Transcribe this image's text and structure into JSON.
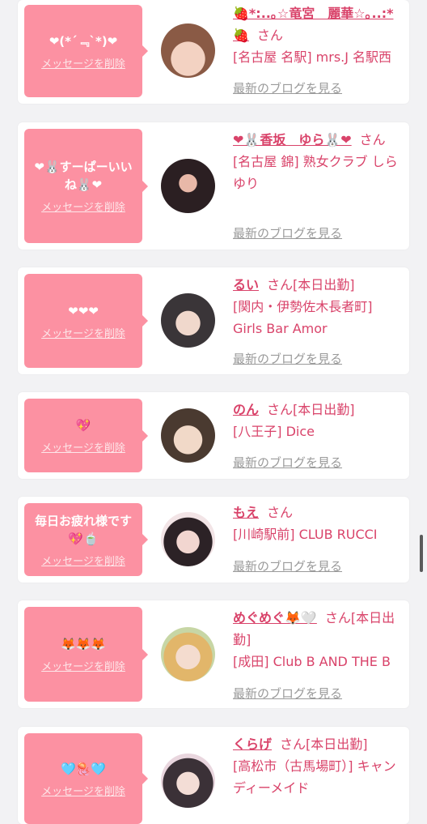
{
  "cards": [
    {
      "message": "❤(*´﹃`*)❤",
      "delete_label": "メッセージを削除",
      "name": "🍓*:..｡☆竜宮　麗華☆｡..:*🍓",
      "san": "さん",
      "store": "[名古屋 名駅] mrs.J 名駅西",
      "blog_label": "最新のブログを見る",
      "avatar_colors": [
        "#e9c3b0",
        "#8a5a45"
      ]
    },
    {
      "message": "❤🐰すーぱーいいね🐰❤",
      "delete_label": "メッセージを削除",
      "name": "❤🐰香坂　ゆら🐰❤",
      "san": "さん",
      "store": "[名古屋 錦] 熟女クラブ しらゆり",
      "blog_label": "最新のブログを見る",
      "avatar_colors": [
        "#5e4a52",
        "#2b1f22"
      ]
    },
    {
      "message": "❤❤❤",
      "delete_label": "メッセージを削除",
      "name": "るい",
      "san": "さん[本日出勤]",
      "store": "[関内・伊勢佐木長者町] Girls Bar Amor",
      "blog_label": "最新のブログを見る",
      "avatar_colors": [
        "#d8d2d6",
        "#3a3538"
      ]
    },
    {
      "message": "💖",
      "delete_label": "メッセージを削除",
      "name": "のん",
      "san": "さん[本日出勤]",
      "store": "[八王子] Dice",
      "blog_label": "最新のブログを見る",
      "avatar_colors": [
        "#d7b9a3",
        "#4a3a30"
      ]
    },
    {
      "message": "毎日お疲れ様です💖🍵",
      "delete_label": "メッセージを削除",
      "name": "もえ",
      "san": "さん",
      "store": "[川崎駅前] CLUB RUCCI",
      "blog_label": "最新のブログを見る",
      "avatar_colors": [
        "#2c2226",
        "#f2e4e6"
      ]
    },
    {
      "message": "🦊🦊🦊",
      "delete_label": "メッセージを削除",
      "name": "めぐめぐ🦊🤍",
      "san": "さん[本日出勤]",
      "store": "[成田] Club B AND THE B",
      "blog_label": "最新のブログを見る",
      "avatar_colors": [
        "#c7d6a5",
        "#e2b66a"
      ]
    },
    {
      "message": "🩵🪼🩵",
      "delete_label": "メッセージを削除",
      "name": "くらげ",
      "san": "さん[本日出勤]",
      "store": "[高松市（古馬場町）] キャンディーメイド",
      "blog_label": "最新のブログを見る",
      "avatar_colors": [
        "#e9d6de",
        "#3b3137"
      ]
    }
  ]
}
